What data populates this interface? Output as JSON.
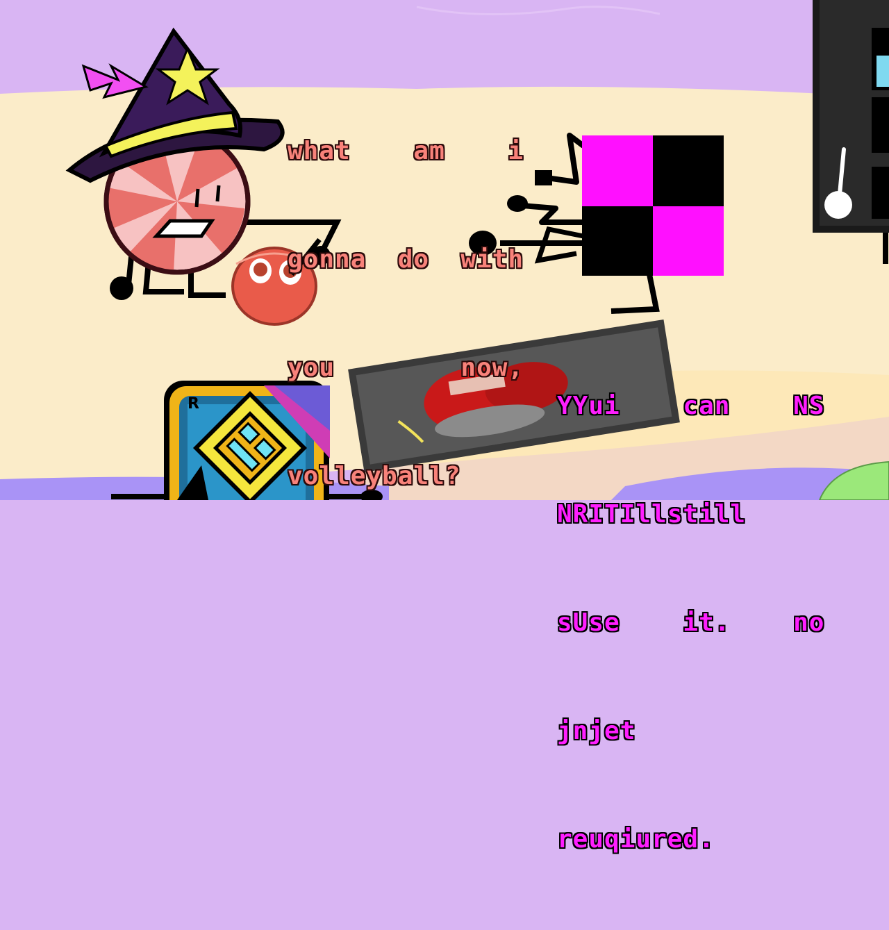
{
  "scene": {
    "colors": {
      "sky": "#d9b5f3",
      "sand": "#fbecc9",
      "water": "#a993f6",
      "grass": "#9be87a",
      "pink_text": "#f8827a",
      "magenta_text": "#ff1eff",
      "checker_magenta": "#ff10ff",
      "checker_black": "#000000"
    }
  },
  "dialogue": {
    "peppermint": {
      "lines": [
        "what    am    i",
        "gonna  do  with",
        "you        now,",
        "volleyball?"
      ]
    },
    "checker": {
      "lines": [
        "YYui    can    NS",
        "NRITIllstill",
        "sUse    it.    no",
        "jnjet",
        "reuqiured."
      ]
    }
  },
  "characters": {
    "peppermint": {
      "icon": "peppermint-wizard-character"
    },
    "volleyball": {
      "icon": "red-puyo-blob-character"
    },
    "checker": {
      "icon": "magenta-black-checkerboard-character"
    },
    "geometry_dash_icon": {
      "icon": "geometry-dash-app-icon",
      "badge": "R"
    }
  }
}
